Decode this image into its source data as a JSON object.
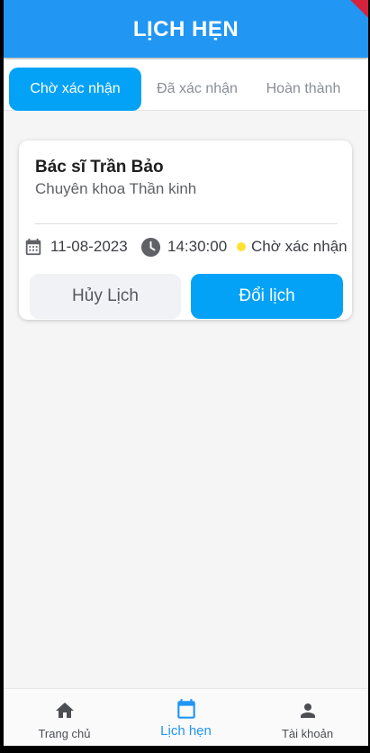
{
  "app_bar": {
    "title": "LỊCH HẸN"
  },
  "tabs": [
    {
      "label": "Chờ xác nhận",
      "active": true
    },
    {
      "label": "Đã xác nhận",
      "active": false
    },
    {
      "label": "Hoàn thành",
      "active": false
    }
  ],
  "appointment": {
    "doctor": "Bác sĩ Trần Bảo",
    "specialty": "Chuyên khoa Thần kinh",
    "date": "11-08-2023",
    "time": "14:30:00",
    "status": "Chờ xác nhận",
    "cancel_label": "Hủy Lịch",
    "reschedule_label": "Đổi lịch"
  },
  "bottom_nav": [
    {
      "label": "Trang chủ",
      "icon": "home-icon",
      "active": false
    },
    {
      "label": "Lịch hẹn",
      "icon": "calendar-icon",
      "active": true
    },
    {
      "label": "Tài khoản",
      "icon": "person-icon",
      "active": false
    }
  ],
  "colors": {
    "primary": "#2196f3",
    "accent": "#03a2f6",
    "status_pending": "#ffe033"
  }
}
